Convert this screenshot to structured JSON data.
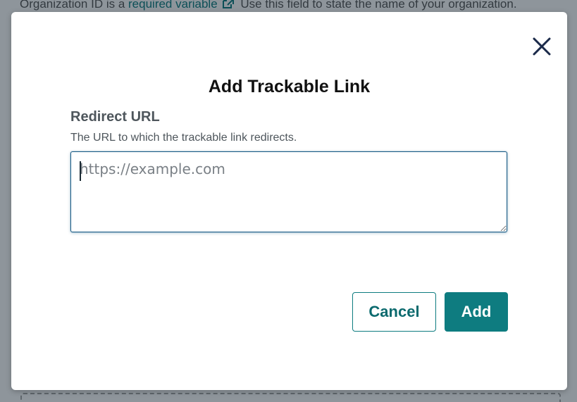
{
  "background": {
    "text_before_link": "Organization ID is a ",
    "link_text": "required variable",
    "text_after_link": " Use this field to state the name of your organization."
  },
  "modal": {
    "title": "Add Trackable Link",
    "field": {
      "label": "Redirect URL",
      "help": "The URL to which the trackable link redirects.",
      "placeholder": "https://example.com",
      "value": ""
    },
    "buttons": {
      "cancel": "Cancel",
      "add": "Add"
    }
  },
  "icons": {
    "close": "close-icon",
    "external_link": "external-link-icon"
  },
  "colors": {
    "accent": "#0e7c80",
    "overlay": "#8e959b",
    "input_border": "#1b5d86"
  }
}
